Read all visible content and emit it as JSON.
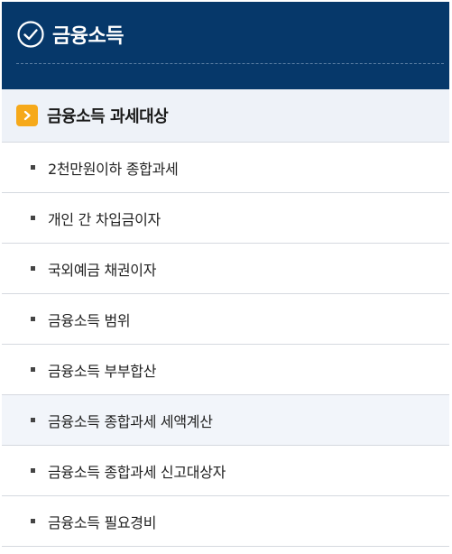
{
  "header": {
    "icon": "check-circle-icon",
    "title": "금융소득"
  },
  "section": {
    "icon": "chevron-right-icon",
    "label": "금융소득 과세대상"
  },
  "colors": {
    "header_bg": "#06386a",
    "section_bg": "#eef2f8",
    "accent": "#f6a91a"
  },
  "menu": [
    {
      "label": "2천만원이하 종합과세",
      "active": false
    },
    {
      "label": "개인 간 차입금이자",
      "active": false
    },
    {
      "label": "국외예금 채권이자",
      "active": false
    },
    {
      "label": "금융소득 범위",
      "active": false
    },
    {
      "label": "금융소득 부부합산",
      "active": false
    },
    {
      "label": "금융소득 종합과세 세액계산",
      "active": true
    },
    {
      "label": "금융소득 종합과세 신고대상자",
      "active": false
    },
    {
      "label": "금융소득 필요경비",
      "active": false
    }
  ]
}
